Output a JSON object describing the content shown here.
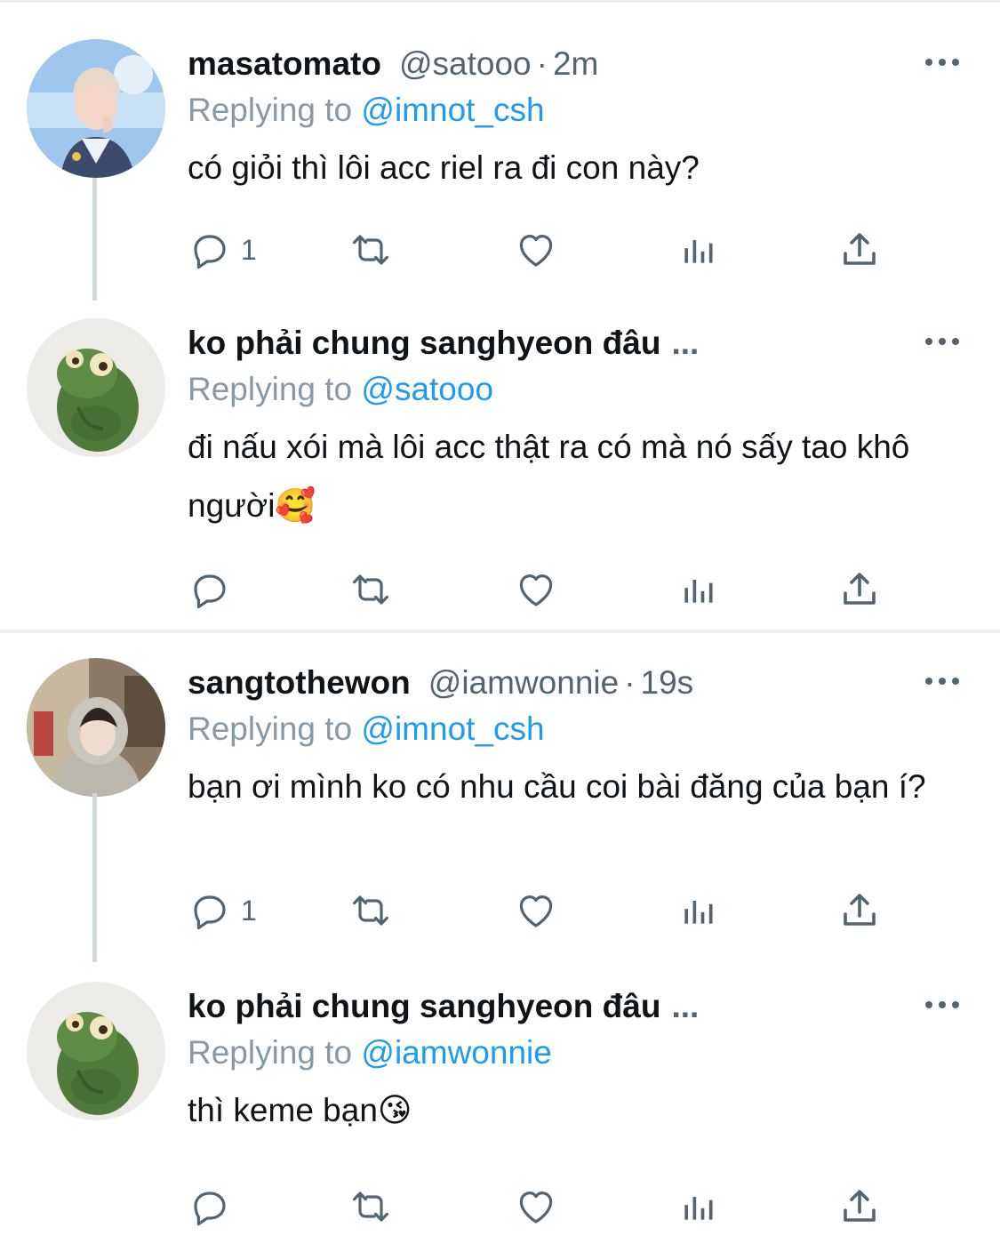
{
  "colors": {
    "link": "#1d9bf0",
    "muted": "#536471",
    "text": "#0f1419",
    "divider": "#ebeef0"
  },
  "tweets": [
    {
      "display_name": "masatomato",
      "handle": "@satooo",
      "separator": "·",
      "time": "2m",
      "reply_prefix": "Replying to",
      "reply_to": "@imnot_csh",
      "text": "có giỏi thì lôi acc riel ra đi con này?",
      "reply_count": "1",
      "avatar": "avatar-boy-in-school-uniform"
    },
    {
      "display_name": "ko phải chung sanghyeon đâu",
      "truncation": "...",
      "reply_prefix": "Replying to",
      "reply_to": "@satooo",
      "text": "đi nấu xói mà lôi acc thật ra có mà nó sấy tao khô người🥰",
      "reply_count": "",
      "avatar": "avatar-green-frog-plush"
    },
    {
      "display_name": "sangtothewon",
      "handle": "@iamwonnie",
      "separator": "·",
      "time": "19s",
      "reply_prefix": "Replying to",
      "reply_to": "@imnot_csh",
      "text": "bạn ơi mình ko có nhu cầu coi bài đăng của bạn í?",
      "reply_count": "1",
      "avatar": "avatar-person-in-hoodie"
    },
    {
      "display_name": "ko phải chung sanghyeon đâu",
      "truncation": "...",
      "reply_prefix": "Replying to",
      "reply_to": "@iamwonnie",
      "text": "thì keme bạn😘",
      "reply_count": "",
      "avatar": "avatar-green-frog-plush"
    }
  ],
  "icons": [
    "reply-icon",
    "retweet-icon",
    "like-icon",
    "views-icon",
    "share-icon",
    "more-icon"
  ]
}
